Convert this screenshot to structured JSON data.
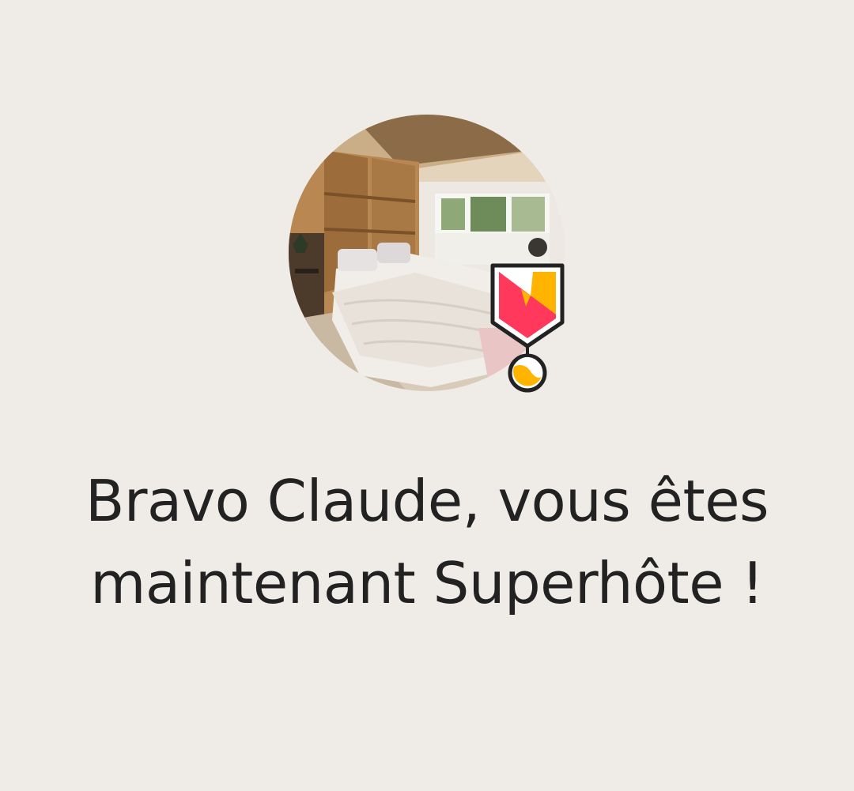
{
  "celebration": {
    "headline": "Bravo Claude, vous êtes maintenant Superhôte !",
    "photo": {
      "subject": "listing-bedroom-photo"
    },
    "badge": {
      "icon": "superhost-medal-icon",
      "colors": {
        "primary": "#FF385C",
        "secondary": "#FFB400",
        "outline": "#222222"
      }
    }
  },
  "theme": {
    "background": "#EFEBE6",
    "text": "#222222"
  }
}
